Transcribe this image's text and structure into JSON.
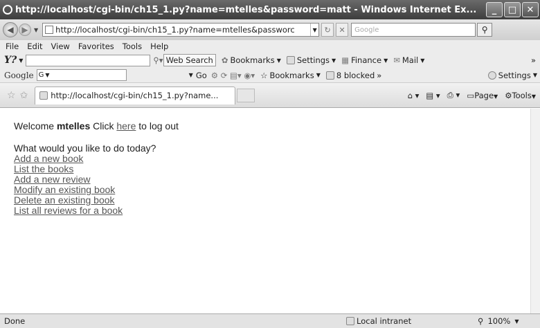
{
  "window": {
    "title": "http://localhost/cgi-bin/ch15_1.py?name=mtelles&password=matt - Windows Internet Ex..."
  },
  "address_bar": {
    "url": "http://localhost/cgi-bin/ch15_1.py?name=mtelles&passworc",
    "search_placeholder": "Google"
  },
  "menu": [
    "File",
    "Edit",
    "View",
    "Favorites",
    "Tools",
    "Help"
  ],
  "yahoo_toolbar": {
    "logo": "Y?",
    "web_search": "Web Search",
    "bookmarks": "Bookmarks",
    "settings": "Settings",
    "finance": "Finance",
    "mail": "Mail"
  },
  "google_toolbar": {
    "logo": "Google",
    "input": "G",
    "go": "Go",
    "bookmarks": "Bookmarks",
    "blocked": "8 blocked",
    "settings": "Settings"
  },
  "tab": {
    "label": "http://localhost/cgi-bin/ch15_1.py?name..."
  },
  "commands": {
    "page": "Page",
    "tools": "Tools"
  },
  "page": {
    "welcome": "Welcome",
    "user": "mtelles",
    "click": "Click",
    "here": "here",
    "logout": "to log out",
    "question": "What would you like to do today?",
    "links": [
      "Add a new book",
      "List the books",
      "Add a new review",
      "Modify an existing book",
      "Delete an existing book",
      "List all reviews for a book"
    ]
  },
  "status": {
    "text": "Done",
    "zone": "Local intranet",
    "zoom": "100%"
  }
}
